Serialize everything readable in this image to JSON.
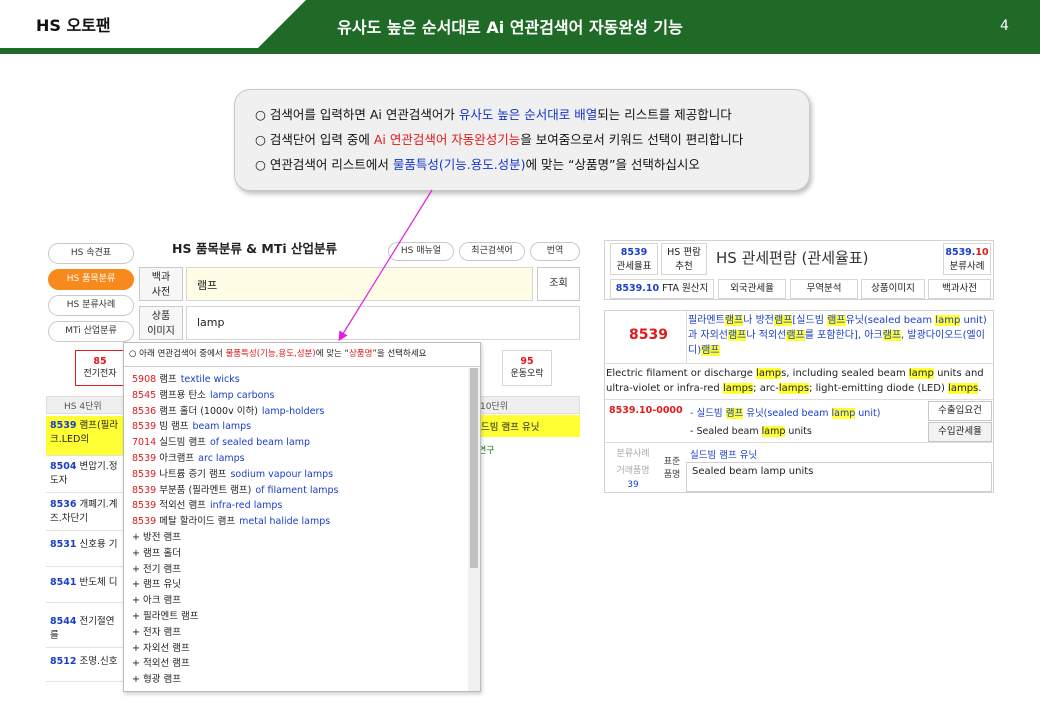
{
  "header": {
    "brand": "HS 오토팬",
    "title": "유사도 높은 순서대로 Ai 연관검색어 자동완성 기능",
    "page": "4"
  },
  "callout": {
    "bullet": "○",
    "l1a": "검색어를 입력하면 Ai 연관검색어가 ",
    "l1b": "유사도 높은 순서대로 배열",
    "l1c": "되는 리스트를 제공합니다",
    "l2a": " 검색단어 입력 중에 ",
    "l2b": "Ai 연관검색어 자동완성기능",
    "l2c": "을 보여줌으로서 키워드 선택이 편리합니다",
    "l3a": " 연관검색어 리스트에서 ",
    "l3b": "물품특성(기능.용도.성분)",
    "l3c": "에 맞는 “상품명”을 선택하십시오"
  },
  "left": {
    "title": "HS 품목분류  &  MTi 산업분류",
    "side": [
      "HS 속견표",
      "HS 품목분류",
      "HS 분류사례",
      "MTi 산업분류"
    ],
    "top_pills": [
      "HS 매뉴얼",
      "최근검색어",
      "번역"
    ],
    "label_dict": [
      "백과",
      "사전"
    ],
    "label_img": [
      "상품",
      "이미지"
    ],
    "input1": "램프",
    "input2": "lamp",
    "search": "조회",
    "cat1": {
      "num": "85",
      "name": "전기전자"
    },
    "cat2": {
      "num": "95",
      "name": "운동오락"
    },
    "col_left": "HS 4단위",
    "col_right": "10단위",
    "rows": [
      {
        "code": "8539",
        "text": "램프(필라",
        "text2": "크.LED의"
      },
      {
        "code": "8504",
        "text": "변압기.정",
        "text2": "도자"
      },
      {
        "code": "8536",
        "text": "개폐기.계",
        "text2": "즈.차단기"
      },
      {
        "code": "8531",
        "text": "신호용 기",
        "text2": ""
      },
      {
        "code": "8541",
        "text": "반도체 디",
        "text2": ""
      },
      {
        "code": "8544",
        "text": "전기절연",
        "text2": "를"
      },
      {
        "code": "8512",
        "text": "조명.신호",
        "text2": ""
      }
    ],
    "right_hl": "드빔 램프 유닛",
    "right_sub": "연구"
  },
  "dropdown": {
    "header_a": "○ 아래 연관검색어 중에서 ",
    "header_b": "물품특성(기능,용도,성분)",
    "header_c": "에 맞는 “",
    "header_d": "상품명",
    "header_e": "”을 선택하세요",
    "items": [
      {
        "code": "5908",
        "ko": "램프",
        "en": "textile wicks"
      },
      {
        "code": "8545",
        "ko": "램프용 탄소",
        "en": "lamp carbons"
      },
      {
        "code": "8536",
        "ko": "램프 홀더 (1000v 이하)",
        "en": "lamp-holders"
      },
      {
        "code": "8539",
        "ko": "빔 램프",
        "en": "beam lamps"
      },
      {
        "code": "7014",
        "ko": "실드빔 램프",
        "en": "of sealed beam lamp"
      },
      {
        "code": "8539",
        "ko": "아크램프",
        "en": "arc lamps"
      },
      {
        "code": "8539",
        "ko": "나트륨 증기 램프",
        "en": "sodium vapour lamps"
      },
      {
        "code": "8539",
        "ko": "부분품 (필라멘트 램프)",
        "en": "of filament lamps"
      },
      {
        "code": "8539",
        "ko": "적외선 램프",
        "en": "infra-red lamps"
      },
      {
        "code": "8539",
        "ko": "메탈 할라이드 램프",
        "en": "metal halide lamps"
      },
      {
        "code": "+",
        "ko": "방전 램프",
        "en": ""
      },
      {
        "code": "+",
        "ko": "램프 홀더",
        "en": ""
      },
      {
        "code": "+",
        "ko": "전기 램프",
        "en": ""
      },
      {
        "code": "+",
        "ko": "램프 유닛",
        "en": ""
      },
      {
        "code": "+",
        "ko": "아크 램프",
        "en": ""
      },
      {
        "code": "+",
        "ko": "필라멘트 램프",
        "en": ""
      },
      {
        "code": "+",
        "ko": "전자 램프",
        "en": ""
      },
      {
        "code": "+",
        "ko": "자외선 램프",
        "en": ""
      },
      {
        "code": "+",
        "ko": "적외선 램프",
        "en": ""
      },
      {
        "code": "+",
        "ko": "형광 램프",
        "en": ""
      }
    ]
  },
  "right": {
    "t_code": "8539",
    "t_code_lbl": "관세율표",
    "t_hs1": "HS 편람",
    "t_hs2": "추천",
    "title": "HS 관세편람 (관세율표)",
    "t_r_code_a": "8539.",
    "t_r_code_b": "10",
    "t_r_lbl": "분류사례",
    "tabs_code": "8539.10",
    "tabs": [
      "FTA 원산지",
      "외국관세율",
      "무역분석",
      "상품이미지",
      "백과사전"
    ],
    "big_code": "8539",
    "ko_1": "필라멘트",
    "ko_2": "램프",
    "ko_3": "나 방전",
    "ko_4": "램프",
    "ko_5": "[실드빔 ",
    "ko_6": "램프",
    "ko_7": "유닛(sealed beam ",
    "ko_8": "lamp",
    "ko_9": " unit) 과 자외선",
    "ko_10": "램프",
    "ko_11": "나 적외선",
    "ko_12": "램프",
    "ko_13": "를 포함한다], 아크",
    "ko_14": "램프",
    "ko_15": ", 발광다이오드(엘이디)",
    "ko_16": "램프",
    "en_1": "Electric filament or discharge ",
    "en_2": "lamp",
    "en_3": "s, including sealed beam ",
    "en_4": "lamp",
    "en_5": " units and ultra-violet or infra-red ",
    "en_6": "lamps",
    "en_7": "; arc-",
    "en_8": "lamps",
    "en_9": "; light-emitting diode (LED) ",
    "en_10": "lamps",
    "en_11": ".",
    "sub_code": "8539.10-0000",
    "sub_ko_1": "- 실드빔 ",
    "sub_ko_2": "램프",
    "sub_ko_3": " 유닛(sealed beam ",
    "sub_ko_4": "lamp",
    "sub_ko_5": " unit)",
    "sub_en_1": "- Sealed beam ",
    "sub_en_2": "lamp",
    "sub_en_3": " units",
    "btn_export": "수출입요건",
    "btn_import": "수입관세율",
    "lbl_case": "분류사례",
    "case_text": "실드빔 램프 유닛",
    "lbl_trade": "거래품명",
    "trade_count": "39",
    "lbl_std1": "표준",
    "lbl_std2": "품명",
    "std_text": "Sealed beam lamp units"
  }
}
